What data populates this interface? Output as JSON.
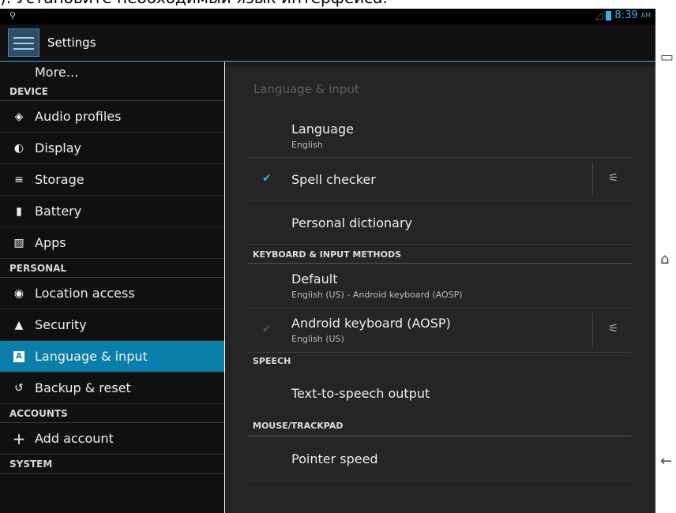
{
  "top_caption": "). Установите необходимый язык интерфейса.",
  "status_bar": {
    "time": "8:39",
    "ampm": "AM"
  },
  "action_bar": {
    "title": "Settings"
  },
  "sidebar": {
    "more_label": "More…",
    "sections": [
      {
        "header": "DEVICE",
        "items": [
          {
            "label": "Audio profiles",
            "icon": "audio-icon"
          },
          {
            "label": "Display",
            "icon": "display-icon"
          },
          {
            "label": "Storage",
            "icon": "storage-icon"
          },
          {
            "label": "Battery",
            "icon": "battery-icon"
          },
          {
            "label": "Apps",
            "icon": "apps-icon"
          }
        ]
      },
      {
        "header": "PERSONAL",
        "items": [
          {
            "label": "Location access",
            "icon": "location-icon"
          },
          {
            "label": "Security",
            "icon": "lock-icon"
          },
          {
            "label": "Language & input",
            "icon": "language-icon",
            "active": true
          },
          {
            "label": "Backup & reset",
            "icon": "backup-icon"
          }
        ]
      },
      {
        "header": "ACCOUNTS",
        "items": [
          {
            "label": "Add account",
            "icon": "plus-icon"
          }
        ]
      },
      {
        "header": "SYSTEM",
        "items": []
      }
    ]
  },
  "detail": {
    "title": "Language & input",
    "language": {
      "title": "Language",
      "subtitle": "English"
    },
    "spell_checker": {
      "title": "Spell checker"
    },
    "personal_dictionary": {
      "title": "Personal dictionary"
    },
    "keyboard_header": "KEYBOARD & INPUT METHODS",
    "default_method": {
      "title": "Default",
      "subtitle": "English (US) - Android keyboard (AOSP)"
    },
    "android_keyboard": {
      "title": "Android keyboard (AOSP)",
      "subtitle": "English (US)"
    },
    "speech_header": "SPEECH",
    "tts": {
      "title": "Text-to-speech output"
    },
    "mouse_header": "MOUSE/TRACKPAD",
    "pointer_speed": {
      "title": "Pointer speed"
    }
  },
  "colors": {
    "accent": "#33b5e5",
    "active_item": "#0a7faa"
  }
}
